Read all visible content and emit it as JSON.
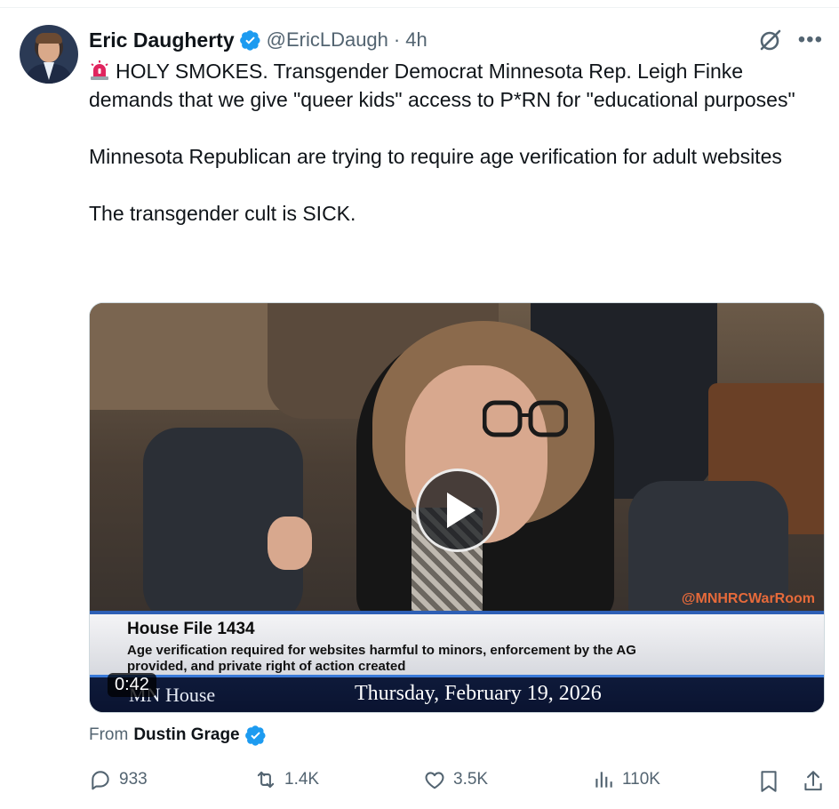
{
  "author": {
    "name": "Eric Daugherty",
    "handle": "@EricLDaugh",
    "separator": "·",
    "time": "4h"
  },
  "tweet": {
    "text": "HOLY SMOKES. Transgender Democrat Minnesota Rep. Leigh Finke demands that we give \"queer kids\" access to P*RN for \"educational purposes\"\n\nMinnesota Republican are trying to require age verification for adult websites\n\nThe transgender cult is SICK."
  },
  "media": {
    "watermark": "@MNHRCWarRoom",
    "lower_third_title": "House File 1434",
    "lower_third_subtitle": "Age verification required for websites harmful to minors, enforcement by the AG provided, and private right of action created",
    "channel": "MN House",
    "date": "Thursday, February 19, 2026",
    "duration": "0:42"
  },
  "attribution": {
    "prefix": "From",
    "name": "Dustin Grage"
  },
  "actions": {
    "replies": "933",
    "reposts": "1.4K",
    "likes": "3.5K",
    "views": "110K"
  },
  "colors": {
    "verified_blue": "#1d9bf0",
    "muted_text": "#536471",
    "siren_red": "#e0245e"
  },
  "icons": [
    "siren-icon",
    "verified-badge-icon",
    "grok-icon",
    "more-icon",
    "play-icon",
    "reply-icon",
    "repost-icon",
    "like-icon",
    "views-icon",
    "bookmark-icon",
    "share-icon"
  ]
}
